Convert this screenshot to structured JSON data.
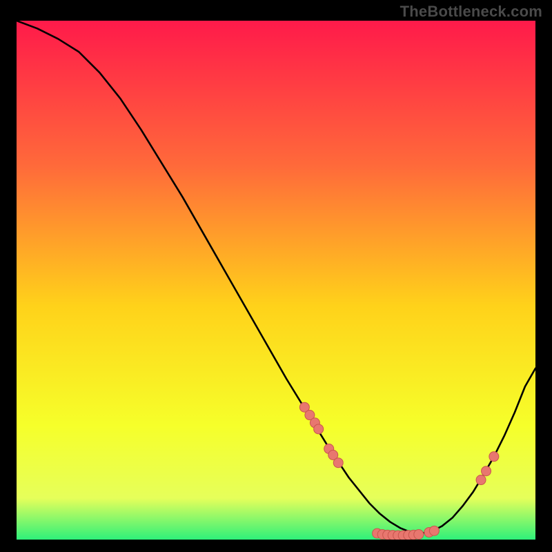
{
  "watermark": "TheBottleneck.com",
  "colors": {
    "frame_bg": "#000000",
    "watermark": "#4a4a4a",
    "gradient_top": "#ff1a4a",
    "gradient_upper": "#ff6a3a",
    "gradient_mid": "#ffd21a",
    "gradient_lower": "#f6ff2a",
    "gradient_band": "#e6ff5a",
    "gradient_bottom": "#2ef07a",
    "curve_stroke": "#000000",
    "marker_fill": "#e8776f",
    "marker_stroke": "#c9554d"
  },
  "chart_data": {
    "type": "line",
    "title": "",
    "xlabel": "",
    "ylabel": "",
    "xlim": [
      0,
      100
    ],
    "ylim": [
      0,
      100
    ],
    "series": [
      {
        "name": "curve",
        "x": [
          0,
          4,
          8,
          12,
          16,
          20,
          24,
          28,
          32,
          36,
          40,
          44,
          48,
          52,
          56,
          60,
          62,
          64,
          66,
          68,
          70,
          72,
          74,
          76,
          78,
          80,
          82,
          84,
          86,
          88,
          90,
          92,
          94,
          96,
          98,
          100
        ],
        "y": [
          100,
          98.5,
          96.5,
          94,
          90,
          85,
          79,
          72.5,
          66,
          59,
          52,
          45,
          38,
          31,
          24.5,
          18,
          15,
          12,
          9.5,
          7,
          5,
          3.4,
          2.2,
          1.4,
          1.2,
          1.6,
          2.6,
          4.2,
          6.5,
          9.2,
          12.5,
          16,
          20,
          24.5,
          29.5,
          33
        ]
      }
    ],
    "markers": [
      {
        "x": 55.5,
        "y": 25.5
      },
      {
        "x": 56.5,
        "y": 24
      },
      {
        "x": 57.5,
        "y": 22.5
      },
      {
        "x": 58.2,
        "y": 21.3
      },
      {
        "x": 60.2,
        "y": 17.5
      },
      {
        "x": 61,
        "y": 16.3
      },
      {
        "x": 62,
        "y": 14.8
      },
      {
        "x": 69.5,
        "y": 1.2
      },
      {
        "x": 70.5,
        "y": 1.0
      },
      {
        "x": 71.5,
        "y": 0.9
      },
      {
        "x": 72.5,
        "y": 0.85
      },
      {
        "x": 73.5,
        "y": 0.8
      },
      {
        "x": 74.5,
        "y": 0.8
      },
      {
        "x": 75.5,
        "y": 0.85
      },
      {
        "x": 76.5,
        "y": 0.9
      },
      {
        "x": 77.5,
        "y": 1.0
      },
      {
        "x": 79.5,
        "y": 1.4
      },
      {
        "x": 80.5,
        "y": 1.7
      },
      {
        "x": 89.5,
        "y": 11.5
      },
      {
        "x": 90.5,
        "y": 13.2
      },
      {
        "x": 92,
        "y": 16
      }
    ]
  }
}
